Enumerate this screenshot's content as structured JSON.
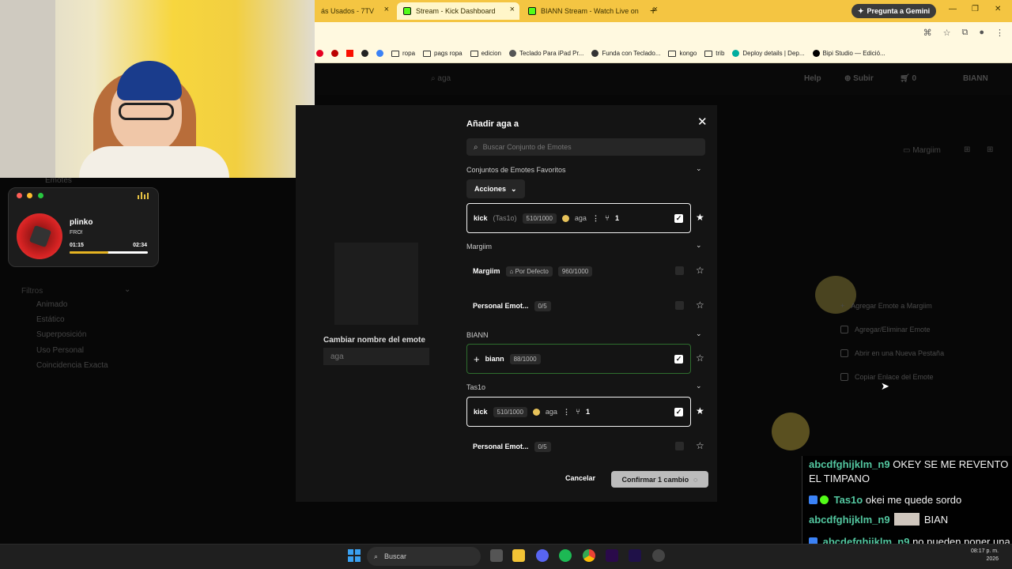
{
  "browser": {
    "tabs": [
      {
        "label": "ás Usados - 7TV"
      },
      {
        "label": "Stream - Kick Dashboard"
      },
      {
        "label": "BIANN Stream - Watch Live on"
      }
    ],
    "gemini_label": "Pregunta a Gemini",
    "bookmarks": [
      "ropa",
      "pags ropa",
      "edicion",
      "Teclado Para iPad Pr...",
      "Funda con Teclado...",
      "kongo",
      "trib",
      "Deploy details | Dep...",
      "Bipi Studio — Edició..."
    ]
  },
  "site": {
    "search_value": "aga",
    "nav": {
      "help": "Help",
      "upload": "Subir",
      "cart_count": "0",
      "user": "BIANN"
    },
    "sidebar_filters_title": "Filtros",
    "sidebar_filters": [
      "Animado",
      "Estático",
      "Superposición",
      "Uso Personal",
      "Coincidencia Exacta"
    ],
    "sidebar_emotes": "Emotes",
    "set_owner_button": "Margiim",
    "context_menu": [
      "Agregar Emote a Margiim",
      "Agregar/Eliminar Emote",
      "Abrir en una Nueva Pestaña",
      "Copiar Enlace del Emote"
    ]
  },
  "music": {
    "title": "plinko",
    "artist": "FRO!",
    "current": "01:15",
    "total": "02:34",
    "progress": 0.49
  },
  "rename": {
    "label": "Cambiar nombre del emote",
    "placeholder": "aga"
  },
  "modal": {
    "title": "Añadir aga a",
    "search_placeholder": "Buscar Conjunto de Emotes",
    "favorites_label": "Conjuntos de Emotes Favoritos",
    "actions_label": "Acciones",
    "fav_row": {
      "name": "kick",
      "owner": "(Tas1o)",
      "capacity": "510/1000",
      "emote": "aga",
      "count": "1"
    },
    "group_margiim": "Margiim",
    "margiim_rows": [
      {
        "name": "Margiim",
        "tag": "Por Defecto",
        "capacity": "960/1000"
      },
      {
        "name": "Personal Emot...",
        "capacity": "0/5"
      }
    ],
    "group_biann": "BIANN",
    "biann_row": {
      "name": "biann",
      "capacity": "88/1000"
    },
    "group_tas1o": "Tas1o",
    "tas1o_rows": [
      {
        "name": "kick",
        "capacity": "510/1000",
        "emote": "aga",
        "count": "1"
      },
      {
        "name": "Personal Emot...",
        "capacity": "0/5"
      }
    ],
    "cancel_label": "Cancelar",
    "confirm_label": "Confirmar 1 cambio"
  },
  "chat": [
    {
      "user": "abcdfghijklm_n9",
      "text": "OKEY SE ME REVENTO EL TIMPANO"
    },
    {
      "user": "Tas1o",
      "text": "okei me quede sordo"
    },
    {
      "user": "abcdfghijklm_n9",
      "text": "BIAN"
    },
    {
      "user": "abcdefghijklm_n9",
      "text": "no pueden poner una palabra q sea referente a trabajar"
    }
  ],
  "taskbar": {
    "search_label": "Buscar",
    "clock_time": "08:17 p. m.",
    "clock_date": "2026"
  }
}
